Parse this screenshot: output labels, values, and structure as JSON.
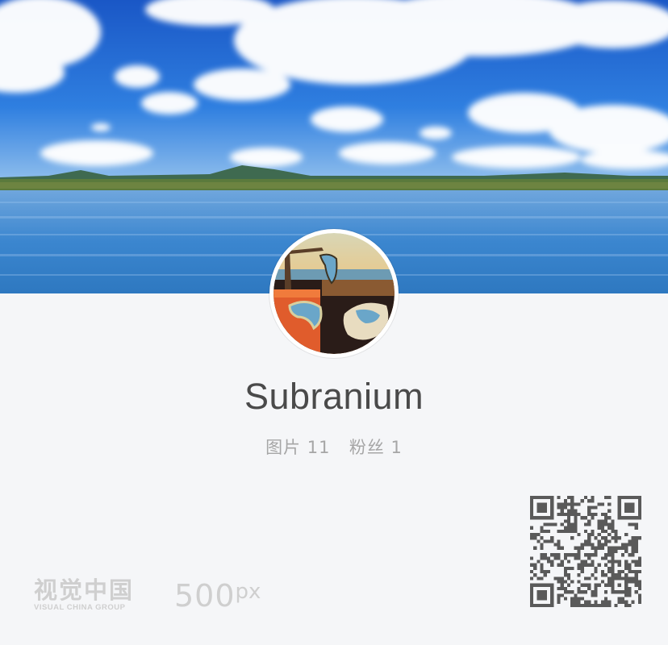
{
  "profile": {
    "username": "Subranium",
    "stats": {
      "photos_label": "图片",
      "photos_count": "11",
      "followers_label": "粉丝",
      "followers_count": "1"
    }
  },
  "footer": {
    "vcg_logo_cn": "视觉中国",
    "vcg_logo_en": "VISUAL CHINA GROUP",
    "px_logo_main": "500",
    "px_logo_suffix": "px"
  },
  "icons": {
    "cover": "lake-landscape-photo",
    "avatar": "surreal-melting-clocks-painting",
    "qr": "qr-code-icon"
  },
  "colors": {
    "background": "#f5f6f8",
    "username": "#4a4a4a",
    "stats": "#a6a6a6",
    "logos": "#cfcfcf",
    "qr": "#5a5a5a"
  }
}
